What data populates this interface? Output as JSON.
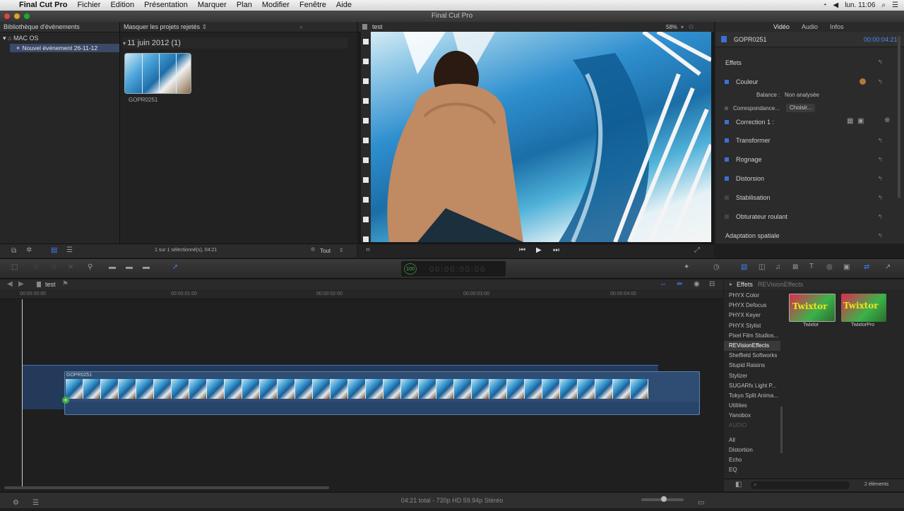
{
  "menubar": {
    "app": "Final Cut Pro",
    "items": [
      "Fichier",
      "Edition",
      "Présentation",
      "Marquer",
      "Plan",
      "Modifier",
      "Fenêtre",
      "Aide"
    ],
    "clock": "lun. 11:06"
  },
  "window": {
    "title": "Final Cut Pro"
  },
  "library": {
    "header": "Bibliothèque d'événements",
    "disk": "MAC OS",
    "event": "Nouvel événement 26-11-12"
  },
  "browser": {
    "filter": "Masquer les projets rejetés",
    "date_group": "11 juin 2012",
    "date_count": "(1)",
    "clip_name": "GOPR0251",
    "selection_status": "1 sur 1 sélectionné(s), 04:21",
    "filter_all": "Tout"
  },
  "viewer": {
    "title": "test",
    "zoom": "58%"
  },
  "inspector": {
    "tabs": [
      "Vidéo",
      "Audio",
      "Infos"
    ],
    "clip_name": "GOPR0251",
    "timecode": "00:00:04:21",
    "section": "Effets",
    "color_label": "Couleur",
    "balance_label": "Balance :",
    "balance_value": "Non analysée",
    "match_label": "Correspondance...",
    "match_button": "Choisir...",
    "correction_label": "Correction 1 :",
    "transform": "Transformer",
    "crop": "Rognage",
    "distortion": "Distorsion",
    "stabilization": "Stabilisation",
    "rolling_shutter": "Obturateur roulant",
    "spatial": "Adaptation spatiale"
  },
  "toolbar": {
    "timecode_display": "100"
  },
  "timeline": {
    "project": "test",
    "ruler": [
      "00:00:00:00",
      "00:00:01:00",
      "00:00:02:00",
      "00:00:03:00",
      "00:00:04:00"
    ],
    "clip_name": "GOPR0251"
  },
  "effects": {
    "header": "Effets",
    "category": "REVisionEffects",
    "list": [
      "PHYX Color",
      "PHYX Defocus",
      "PHYX Keyer",
      "PHYX Stylist",
      "Pixel Film Studios...",
      "REVisionEffects",
      "Sheffield Softworks",
      "Stupid Raisins",
      "Stylizer",
      "SUGARfx Light P...",
      "Tokyo Split Anima...",
      "Utilities",
      "Yanobox"
    ],
    "audio_header": "AUDIO",
    "audio_list": [
      "All",
      "Distortion",
      "Echo",
      "EQ"
    ],
    "thumbs": [
      {
        "title": "Twixtor",
        "label": "Twixtor"
      },
      {
        "title": "Twixtor",
        "label": "TwixtorPro"
      }
    ],
    "count": "2 éléments"
  },
  "status": {
    "text": "04:21 total - 720p HD 59.94p Stéréo"
  }
}
